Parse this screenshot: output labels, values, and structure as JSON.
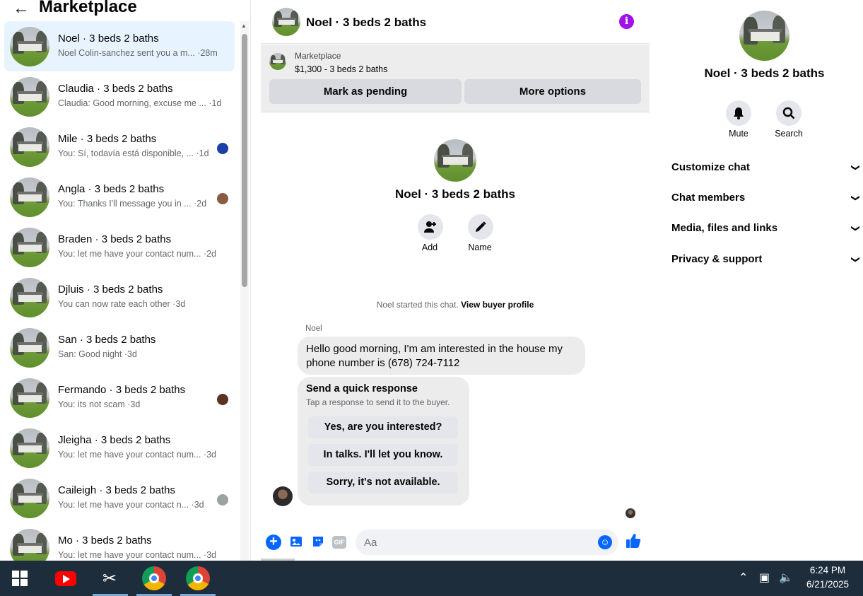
{
  "left_panel": {
    "back_icon": "arrow-left-icon",
    "title": "Marketplace",
    "conversations": [
      {
        "name": "Noel · 3 beds 2 baths",
        "preview": "Noel Colin-sanchez sent you a m... ·28m",
        "active": true,
        "mini_color": ""
      },
      {
        "name": "Claudia · 3 beds 2 baths",
        "preview": "Claudia: Good morning, excuse me ... ·1d",
        "mini_color": ""
      },
      {
        "name": "Mile · 3 beds 2 baths",
        "preview": "You: Sí, todavía está disponible, ...  ·1d",
        "mini_color": "#1c3fa8"
      },
      {
        "name": "Angla · 3 beds 2 baths",
        "preview": "You: Thanks I'll message you in ... ·2d",
        "mini_color": "#8a5a43"
      },
      {
        "name": "Braden · 3 beds 2 baths",
        "preview": "You: let me have your contact num... ·2d",
        "mini_color": ""
      },
      {
        "name": "Djluis · 3 beds 2 baths",
        "preview": "You can now rate each other ·3d",
        "mini_color": ""
      },
      {
        "name": "San · 3 beds 2 baths",
        "preview": "San: Good night ·3d",
        "mini_color": ""
      },
      {
        "name": "Fermando · 3 beds 2 baths",
        "preview": "You: its not scam ·3d",
        "mini_color": "#5a3322"
      },
      {
        "name": "Jleigha · 3 beds 2 baths",
        "preview": "You: let me have your contact num... ·3d",
        "mini_color": ""
      },
      {
        "name": "Caileigh · 3 beds 2 baths",
        "preview": "You: let me have your contact n... ·3d",
        "mini_color": "#9aa3a0"
      },
      {
        "name": "Mo · 3 beds 2 baths",
        "preview": "You: let me have your contact num... ·3d",
        "mini_color": ""
      }
    ]
  },
  "chat": {
    "header_name": "Noel · 3 beds 2 baths",
    "info_icon": "info-icon",
    "marketplace_label": "Marketplace",
    "listing": "$1,300 - 3 beds 2 baths",
    "mark_pending": "Mark as pending",
    "more_options": "More options",
    "intro_name": "Noel · 3 beds 2 baths",
    "add_label": "Add",
    "name_label": "Name",
    "started_text": "Noel started this chat.",
    "buyer_profile_link": "View buyer profile",
    "sender": "Noel",
    "message": "Hello good morning, I'm am interested in the house my phone number is (678) 724-7112",
    "quick_title": "Send a quick response",
    "quick_sub": "Tap a response to send it to the buyer.",
    "quick_responses": [
      "Yes, are you interested?",
      "In talks. I'll let you know.",
      "Sorry, it's not available."
    ],
    "composer_placeholder": "Aa",
    "gif_label": "GIF"
  },
  "details": {
    "name": "Noel · 3 beds 2 baths",
    "mute_label": "Mute",
    "search_label": "Search",
    "sections": [
      "Customize chat",
      "Chat members",
      "Media, files and links",
      "Privacy & support"
    ]
  },
  "taskbar": {
    "time": "6:24 PM",
    "date": "6/21/2025"
  },
  "colors": {
    "accent": "#0866ff",
    "info": "#a012e6",
    "active_row": "#e7f3ff",
    "taskbar": "#1e2d3c"
  }
}
